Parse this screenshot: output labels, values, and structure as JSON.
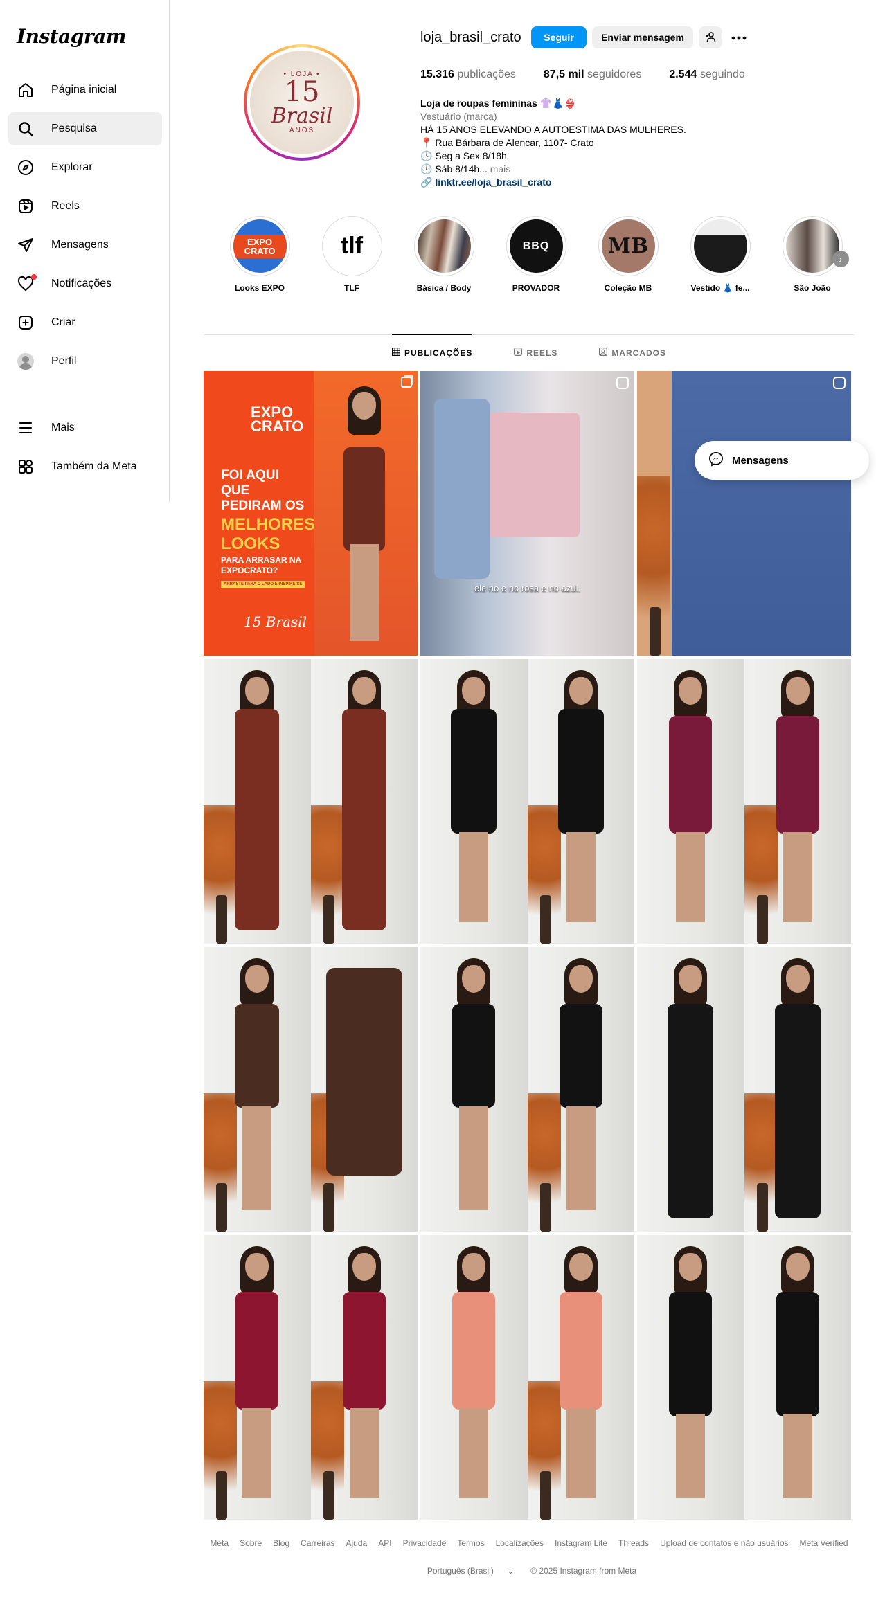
{
  "sidebar": {
    "logo": "Instagram",
    "items": [
      {
        "label": "Página inicial",
        "icon": "home-icon"
      },
      {
        "label": "Pesquisa",
        "icon": "search-icon"
      },
      {
        "label": "Explorar",
        "icon": "compass-icon"
      },
      {
        "label": "Reels",
        "icon": "reels-icon"
      },
      {
        "label": "Mensagens",
        "icon": "send-icon"
      },
      {
        "label": "Notificações",
        "icon": "heart-icon"
      },
      {
        "label": "Criar",
        "icon": "plus-square-icon"
      },
      {
        "label": "Perfil",
        "icon": "avatar"
      }
    ],
    "bottom": [
      {
        "label": "Mais",
        "icon": "menu-icon"
      },
      {
        "label": "Também da Meta",
        "icon": "meta-apps-icon"
      }
    ]
  },
  "profile": {
    "username": "loja_brasil_crato",
    "follow_label": "Seguir",
    "message_label": "Enviar mensagem",
    "stats": {
      "posts_value": "15.316",
      "posts_label": "publicações",
      "followers_value": "87,5 mil",
      "followers_label": "seguidores",
      "following_value": "2.544",
      "following_label": "seguindo"
    },
    "bio": {
      "name": "Loja de roupas femininas 👚👗👙",
      "category": "Vestuário (marca)",
      "line1": "HÁ 15 ANOS ELEVANDO A AUTOESTIMA DAS MULHERES.",
      "line2": "📍 Rua Bárbara de Alencar, 1107- Crato",
      "line3": "🕓 Seg a Sex 8/18h",
      "line4": "🕓 Sáb 8/14h...",
      "more": "mais",
      "link": "linktr.ee/loja_brasil_crato"
    },
    "pic": {
      "loja": "• LOJA •",
      "number": "15",
      "brand": "Brasil",
      "anos": "ANOS"
    }
  },
  "highlights": [
    {
      "label": "Looks EXPO",
      "mark": "EXPO CRATO"
    },
    {
      "label": "TLF",
      "mark": "tlf"
    },
    {
      "label": "Básica / Body",
      "mark": ""
    },
    {
      "label": "PROVADOR",
      "mark": "BBQ"
    },
    {
      "label": "Coleção MB",
      "mark": "MB"
    },
    {
      "label": "Vestido 👗 fe...",
      "mark": ""
    },
    {
      "label": "São João",
      "mark": ""
    }
  ],
  "tabs": [
    {
      "label": "PUBLICAÇÕES",
      "icon": "grid-icon"
    },
    {
      "label": "REELS",
      "icon": "reels-icon"
    },
    {
      "label": "MARCADOS",
      "icon": "tagged-icon"
    }
  ],
  "posts": {
    "p1": {
      "expo": "EXPO CRATO",
      "line1": "FOI AQUI QUE PEDIRAM OS",
      "line2": "MELHORES LOOKS",
      "line3": "PARA ARRASAR NA EXPOCRATO?",
      "line4": "ARRASTE PARA O LADO E INSPIRE-SE",
      "brand": "15 Brasil"
    },
    "p2_caption": "ele no e no rosa e no azul.",
    "colors": [
      "#7a2e22",
      "#111111",
      "#7a1a3a",
      "#4a2c20",
      "#121212",
      "#151515",
      "#8e1530",
      "#e8907a",
      "#111111"
    ]
  },
  "messages_float": {
    "label": "Mensagens"
  },
  "footer": {
    "links": [
      "Meta",
      "Sobre",
      "Blog",
      "Carreiras",
      "Ajuda",
      "API",
      "Privacidade",
      "Termos",
      "Localizações",
      "Instagram Lite",
      "Threads",
      "Upload de contatos e não usuários",
      "Meta Verified"
    ],
    "language": "Português (Brasil)",
    "copyright": "© 2025 Instagram from Meta"
  }
}
